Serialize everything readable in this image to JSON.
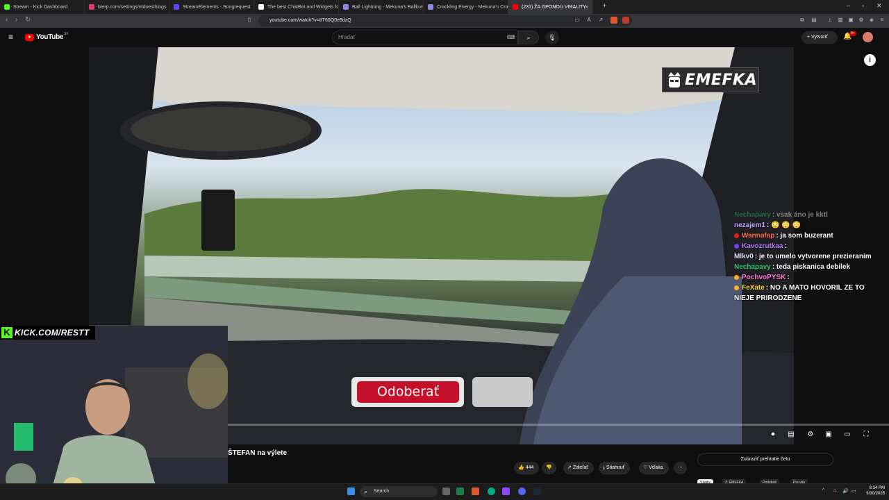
{
  "browser": {
    "tabs": [
      {
        "title": "Stream - Kick Dashboard",
        "color": "#53fc18"
      },
      {
        "title": "blerp.com/settings/ntdoesthings",
        "color": "#e6397a"
      },
      {
        "title": "StreamElements - Songrequest",
        "color": "#5a4bff"
      },
      {
        "title": "The best ChatBot and Widgets for Ki",
        "color": "#ffffff"
      },
      {
        "title": "Ball Lightning - Mekuna's Ballkuna",
        "color": "#8a8ae0"
      },
      {
        "title": "Crackling Energy - Mekuna's Crackun",
        "color": "#8a8ae0"
      },
      {
        "title": "(231) ŽA OPONOU VIRALITY",
        "color": "#ff0000",
        "active": true
      }
    ],
    "url": "youtube.com/watch?v=8T60Q0e8dzQ"
  },
  "youtube": {
    "logo_text": "YouTube",
    "region": "SK",
    "search_placeholder": "Hľadať",
    "create_label": "Vytvoriť",
    "notif_count": "9+"
  },
  "video": {
    "watermark": "EMEFKA",
    "info_label": "i",
    "subscribe_text": "Odoberať",
    "title": "ŠTEFAN na výlete"
  },
  "stream_overlay": {
    "kick_letter": "K",
    "kick_url": "KICK.COM/RESTT"
  },
  "chat": [
    {
      "user": "Nechapavy",
      "text": ": vsak áno je kktl",
      "color": "#2ecc71",
      "dim": true
    },
    {
      "user": "nezajem1",
      "text": ": 😳 😳 😳",
      "color": "#c9a0ff"
    },
    {
      "user": "Wannafap",
      "text": ": ja som buzerant",
      "color": "#ff6b4a",
      "badge": "#e02020"
    },
    {
      "user": "Kavozrutkaa",
      "text": ":",
      "color": "#b47cff",
      "badge": "#7a3cff"
    },
    {
      "user": "Mlkv0",
      "text": ": je to umelo vytvorene prezieranim",
      "color": "#e0e0ff"
    },
    {
      "user": "Nechapavy",
      "text": ": teda piskanica debilek",
      "color": "#2ecc71"
    },
    {
      "user": "PochvoPYSK",
      "text": ":",
      "color": "#ff7ad9",
      "badge": "#ffb020"
    },
    {
      "user": "FeXate",
      "text": ": NO A MATO HOVORIL ZE TO NIEJE PRIRODZENE",
      "color": "#ffd23f",
      "badge": "#ffb020"
    }
  ],
  "actions": {
    "likes": "444",
    "share": "Zdieľať",
    "download": "Stiahnuť",
    "thanks": "Vďaka",
    "more": "⋯",
    "chat_replay": "Zobraziť prehratie četu"
  },
  "chips": [
    "Všetky",
    "Z: EMEFKA",
    "Podobné",
    "Pre vás"
  ],
  "taskbar": {
    "search_label": "Search",
    "time": "8:34 PM",
    "date": "9/30/2025"
  }
}
